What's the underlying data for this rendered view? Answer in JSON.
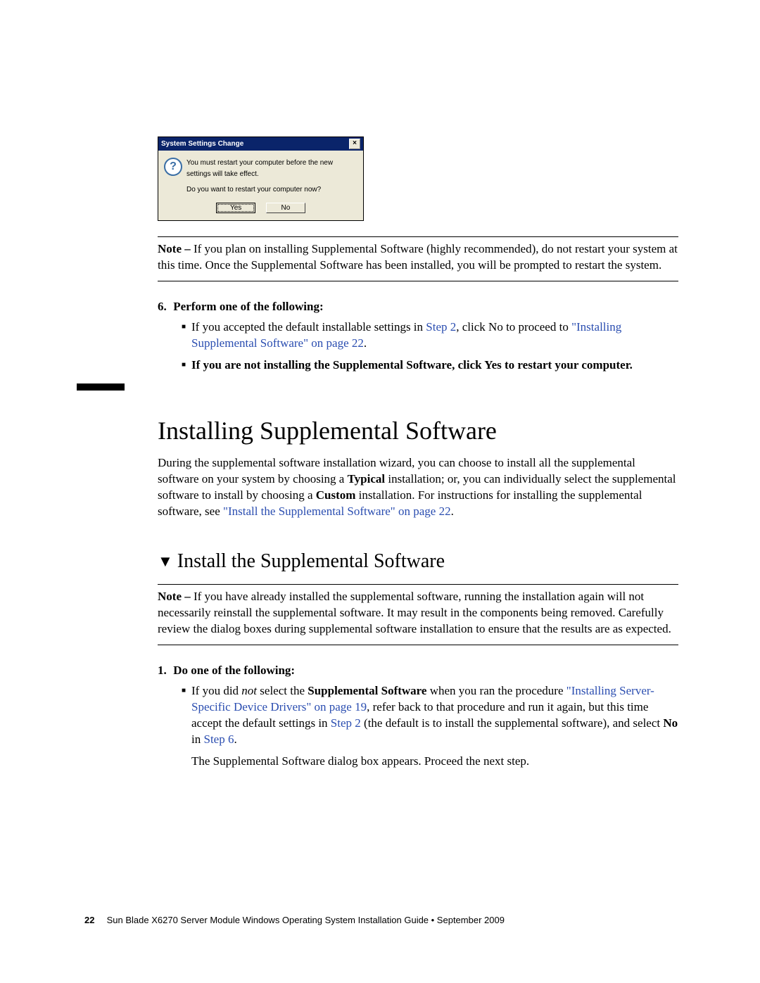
{
  "dialog": {
    "title": "System Settings Change",
    "close": "×",
    "line1": "You must restart your computer before the new settings will take effect.",
    "line2": "Do you want to restart your computer now?",
    "yes": "Yes",
    "no": "No"
  },
  "note1": {
    "label": "Note –",
    "text": " If you plan on installing Supplemental Software (highly recommended), do not restart your system at this time. Once the Supplemental Software has been installed, you will be prompted to restart the system."
  },
  "step6": {
    "num": "6.",
    "text": "Perform one of the following:"
  },
  "s6b1": {
    "pre": "If you accepted the default installable settings in ",
    "step2": "Step 2",
    "mid": ", click No to proceed to ",
    "link": "\"Installing Supplemental Software\" on page 22",
    "post": "."
  },
  "s6b2": "If you are not installing the Supplemental Software, click Yes to restart your computer.",
  "h1": "Installing Supplemental Software",
  "p1": {
    "t1": "During the supplemental software installation wizard, you can choose to install all the supplemental software on your system by choosing a ",
    "b1": "Typical",
    "t2": " installation; or, you can individually select the supplemental software to install by choosing a ",
    "b2": "Custom",
    "t3": " installation. For instructions for installing the supplemental software, see ",
    "link": "\"Install the Supplemental Software\" on page 22",
    "t4": "."
  },
  "h2": "Install the Supplemental Software",
  "note2": {
    "label": "Note –",
    "text": " If you have already installed the supplemental software, running the installation again will not necessarily reinstall the supplemental software. It may result in the components being removed. Carefully review the dialog boxes during supplemental software installation to ensure that the results are as expected."
  },
  "step1": {
    "num": "1.",
    "text": "Do one of the following:"
  },
  "s1b1": {
    "t1": "If you did ",
    "i1": "not",
    "t2": " select the ",
    "b1": "Supplemental Software",
    "t3": " when you ran the procedure ",
    "link1": "\"Installing Server-Specific Device Drivers\" on page 19",
    "t4": ", refer back to that procedure and run it again, but this time accept the default settings in ",
    "step2": "Step 2",
    "t5": " (the default is to install the supplemental software), and select ",
    "b2": "No",
    "t6": " in ",
    "step6": "Step 6",
    "t7": "."
  },
  "s1p2": "The Supplemental Software dialog box appears. Proceed the next step.",
  "footer": {
    "page": "22",
    "text": "Sun Blade X6270 Server Module Windows Operating System Installation Guide  •  September 2009"
  }
}
